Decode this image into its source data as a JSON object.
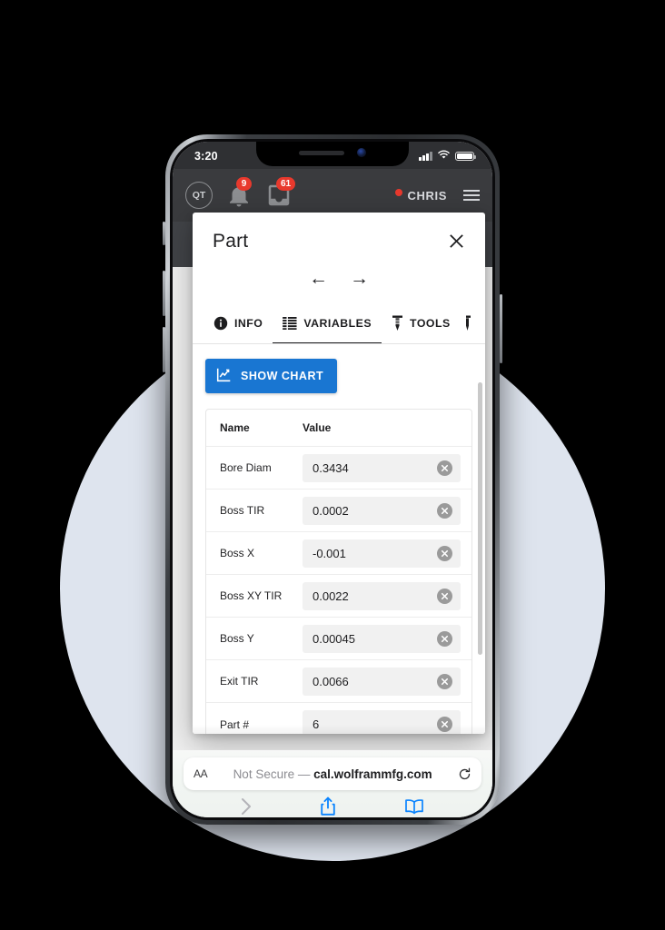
{
  "status_bar": {
    "time": "3:20",
    "signal_icon": "cellular-signal-icon",
    "wifi_icon": "wifi-icon",
    "battery_icon": "battery-icon"
  },
  "app_bar": {
    "logo_text": "QT",
    "logo_icon": "app-logo-icon",
    "notification_icon": "bell-icon",
    "notification_badge": "9",
    "messages_icon": "inbox-icon",
    "messages_badge": "61",
    "user_name": "CHRIS",
    "user_alert_icon": "alert-dot-icon",
    "menu_icon": "hamburger-menu-icon",
    "dropdown_icon": "chevron-down-icon"
  },
  "modal": {
    "title": "Part",
    "close_icon": "close-icon",
    "prev_icon": "arrow-left-icon",
    "prev_label": "←",
    "next_icon": "arrow-right-icon",
    "next_label": "→",
    "tabs": [
      {
        "label": "INFO",
        "icon": "info-icon",
        "active": false
      },
      {
        "label": "VARIABLES",
        "icon": "list-icon",
        "active": true
      },
      {
        "label": "TOOLS",
        "icon": "screw-icon",
        "active": false
      }
    ],
    "show_chart": {
      "label": "SHOW CHART",
      "icon": "chart-icon",
      "color": "#1976d2"
    },
    "table": {
      "columns": [
        "Name",
        "Value"
      ],
      "clear_icon": "clear-field-icon",
      "rows": [
        {
          "name": "Bore Diam",
          "value": "0.3434"
        },
        {
          "name": "Boss TIR",
          "value": "0.0002"
        },
        {
          "name": "Boss X",
          "value": "-0.001"
        },
        {
          "name": "Boss XY TIR",
          "value": "0.0022"
        },
        {
          "name": "Boss Y",
          "value": "0.00045"
        },
        {
          "name": "Exit TIR",
          "value": "0.0066"
        },
        {
          "name": "Part #",
          "value": "6"
        }
      ]
    }
  },
  "browser": {
    "text_size_label": "AA",
    "text_size_icon": "text-size-icon",
    "security_label": "Not Secure — ",
    "domain": "cal.wolframmfg.com",
    "reload_icon": "reload-icon",
    "back_icon": "chevron-left-icon",
    "forward_icon": "chevron-right-icon",
    "share_icon": "share-icon",
    "bookmarks_icon": "book-icon",
    "tabs_icon": "tabs-icon"
  },
  "theme": {
    "accent": "#1976d2",
    "badge": "#e8392d",
    "backdrop": "#dee4ee",
    "appbar": "#3a3b3e"
  }
}
